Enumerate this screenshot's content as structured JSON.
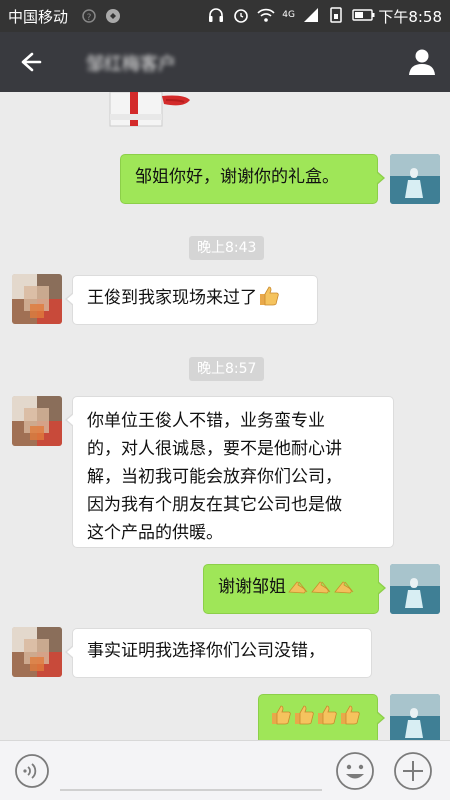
{
  "status_bar": {
    "carrier": "中国移动",
    "network": "4G",
    "time": "下午8:58"
  },
  "header": {
    "title": "邹红梅客户"
  },
  "messages": [
    {
      "side": "right",
      "text": "邹姐你好，谢谢你的礼盒。",
      "emoji": ""
    },
    {
      "timestamp": "晚上8:43"
    },
    {
      "side": "left",
      "text": "王俊到我家现场来过了",
      "emoji": "thumbs-up"
    },
    {
      "timestamp": "晚上8:57"
    },
    {
      "side": "left",
      "lines": [
        "你单位王俊人不错，业务蛮专业",
        "的，对人很诚恳，要不是他耐心讲",
        "解，当初我可能会放弃你们公司，",
        "因为我有个朋友在其它公司也是做",
        "这个产品的供暖。"
      ]
    },
    {
      "side": "right",
      "text": "谢谢邹姐",
      "emoji": "folded-hands"
    },
    {
      "side": "left",
      "text": "事实证明我选择你们公司没错，"
    },
    {
      "side": "right",
      "text": "",
      "emoji": "thumbs-up"
    }
  ],
  "icons": {
    "signal": "signal-icon",
    "headphones": "headphones-icon",
    "alarm": "alarm-icon",
    "wifi": "wifi-icon",
    "sim": "sim-icon",
    "battery": "battery-icon",
    "back": "back-arrow-icon",
    "profile": "profile-icon",
    "voice": "voice-icon",
    "emoji": "smiley-icon",
    "more": "plus-icon"
  },
  "colors": {
    "header_bg": "#393a3f",
    "status_bg": "#343434",
    "chat_bg": "#ebebeb",
    "own_bubble": "#9fe658",
    "other_bubble": "#ffffff"
  }
}
